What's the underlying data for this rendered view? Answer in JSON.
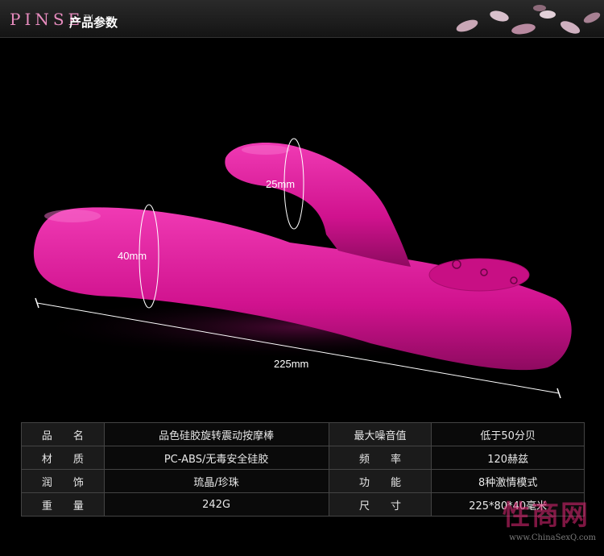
{
  "header": {
    "brand": "PINSE",
    "tm": "TM",
    "title": "产品参数"
  },
  "dimensions": {
    "tip_diameter": "25mm",
    "shaft_diameter": "40mm",
    "length": "225mm"
  },
  "specs": [
    {
      "k1": "品　　名",
      "v1": "品色硅胶旋转震动按摩棒",
      "k2": "最大噪音值",
      "v2": "低于50分贝"
    },
    {
      "k1": "材　　质",
      "v1": "PC-ABS/无毒安全硅胶",
      "k2": "频　　率",
      "v2": "120赫兹"
    },
    {
      "k1": "润　　饰",
      "v1": "琉晶/珍珠",
      "k2": "功　　能",
      "v2": "8种激情模式"
    },
    {
      "k1": "重　　量",
      "v1": "242G",
      "k2": "尺　　寸",
      "v2": "225*80*40毫米"
    }
  ],
  "watermark": {
    "text": "性商网",
    "url": "www.ChinaSexQ.com"
  },
  "colors": {
    "product": "#e0169a",
    "brand": "#e88cbf"
  }
}
